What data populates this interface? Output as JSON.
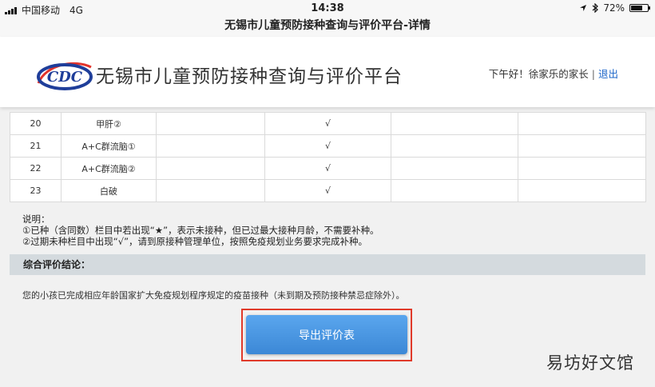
{
  "status_bar": {
    "carrier": "中国移动",
    "network": "4G",
    "time": "14:38",
    "battery_pct": "72%",
    "battery_level": 0.72,
    "icons": [
      "signal-icon",
      "location-icon",
      "bluetooth-icon",
      "battery-icon"
    ]
  },
  "page_title": "无锡市儿童预防接种查询与评价平台-详情",
  "header": {
    "logo_text": "CDC",
    "site_title": "无锡市儿童预防接种查询与评价平台",
    "greeting": "下午好！徐家乐的家长",
    "separator": "|",
    "logout_label": "退出"
  },
  "table": {
    "rows": [
      {
        "no": "20",
        "vaccine": "甲肝②",
        "col3": "",
        "col4": "√",
        "col5": "",
        "col6": ""
      },
      {
        "no": "21",
        "vaccine": "A+C群流脑①",
        "col3": "",
        "col4": "√",
        "col5": "",
        "col6": ""
      },
      {
        "no": "22",
        "vaccine": "A+C群流脑②",
        "col3": "",
        "col4": "√",
        "col5": "",
        "col6": ""
      },
      {
        "no": "23",
        "vaccine": "白破",
        "col3": "",
        "col4": "√",
        "col5": "",
        "col6": ""
      }
    ]
  },
  "notes": {
    "title": "说明：",
    "line1": "①已种（含同数）栏目中若出现“★”，表示未接种，但已过最大接种月龄，不需要补种。",
    "line2": "②过期未种栏目中出现“√”，请到原接种管理单位，按照免疫规划业务要求完成补种。"
  },
  "summary": {
    "label": "综合评价结论：",
    "text": "您的小孩已完成相应年龄国家扩大免疫规划程序规定的疫苗接种（未到期及预防接种禁忌症除外）。"
  },
  "export_button_label": "导出评价表",
  "watermark": "易坊好文馆",
  "colors": {
    "accent_blue": "#3c88d6",
    "highlight_red": "#e03a2a",
    "summary_bar": "#d4dade",
    "logout_link": "#1a64c8"
  }
}
